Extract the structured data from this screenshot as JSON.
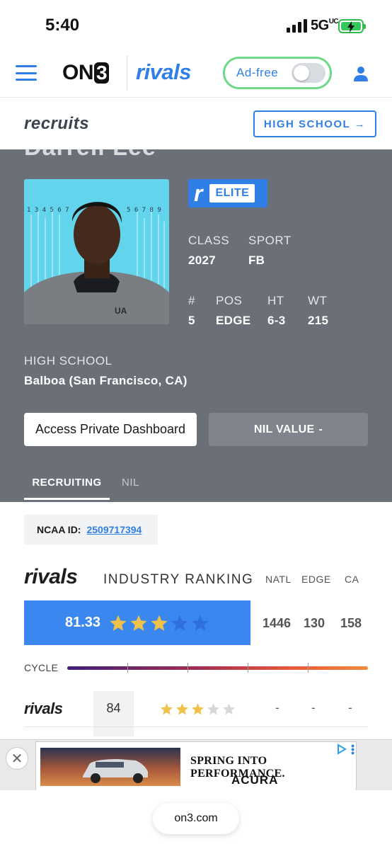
{
  "status_bar": {
    "time": "5:40",
    "network": "5G",
    "network_suffix": "UC"
  },
  "nav": {
    "logo_on3": "ON",
    "logo_on3_three": "3",
    "logo_rivals": "rivals",
    "adfree_label": "Ad-free",
    "adfree_enabled": false
  },
  "subheader": {
    "logo": "recruits",
    "high_school_button": "HIGH SCHOOL →"
  },
  "profile": {
    "name_partial": "Darrell Lee",
    "badge": {
      "letter": "r",
      "label": "ELITE"
    },
    "class_label": "CLASS",
    "class_value": "2027",
    "sport_label": "SPORT",
    "sport_value": "FB",
    "number_label": "#",
    "number_value": "5",
    "pos_label": "POS",
    "pos_value": "EDGE",
    "ht_label": "HT",
    "ht_value": "6-3",
    "wt_label": "WT",
    "wt_value": "215",
    "high_school_label": "HIGH SCHOOL",
    "high_school_value": "Balboa (San Francisco, CA)",
    "access_button": "Access Private Dashboard",
    "nil_button_label": "NIL VALUE",
    "nil_button_value": "-",
    "tabs": [
      {
        "label": "RECRUITING",
        "active": true
      },
      {
        "label": "NIL",
        "active": false
      }
    ]
  },
  "ncaa": {
    "label": "NCAA ID:",
    "value": "2509717394"
  },
  "ranking": {
    "logo": "rivals",
    "title": "INDUSTRY RANKING",
    "columns": [
      "NATL",
      "EDGE",
      "CA"
    ],
    "score": "81.33",
    "stars_filled": 3,
    "stars_total": 5,
    "values": [
      "1446",
      "130",
      "158"
    ],
    "cycle_label": "CYCLE",
    "rivals_row": {
      "logo": "rivals",
      "rating": "84",
      "stars_filled": 3,
      "stars_total": 5,
      "values": [
        "-",
        "-",
        "-"
      ]
    }
  },
  "ad": {
    "headline": "SPRING INTO PERFORMANCE.",
    "brand": "ACURA"
  },
  "browser": {
    "url": "on3.com"
  },
  "colors": {
    "accent": "#2f7fe6",
    "star": "#f0c24a",
    "star_empty_blue": "#2f6fdd",
    "profile_bg": "#6b6f78"
  }
}
